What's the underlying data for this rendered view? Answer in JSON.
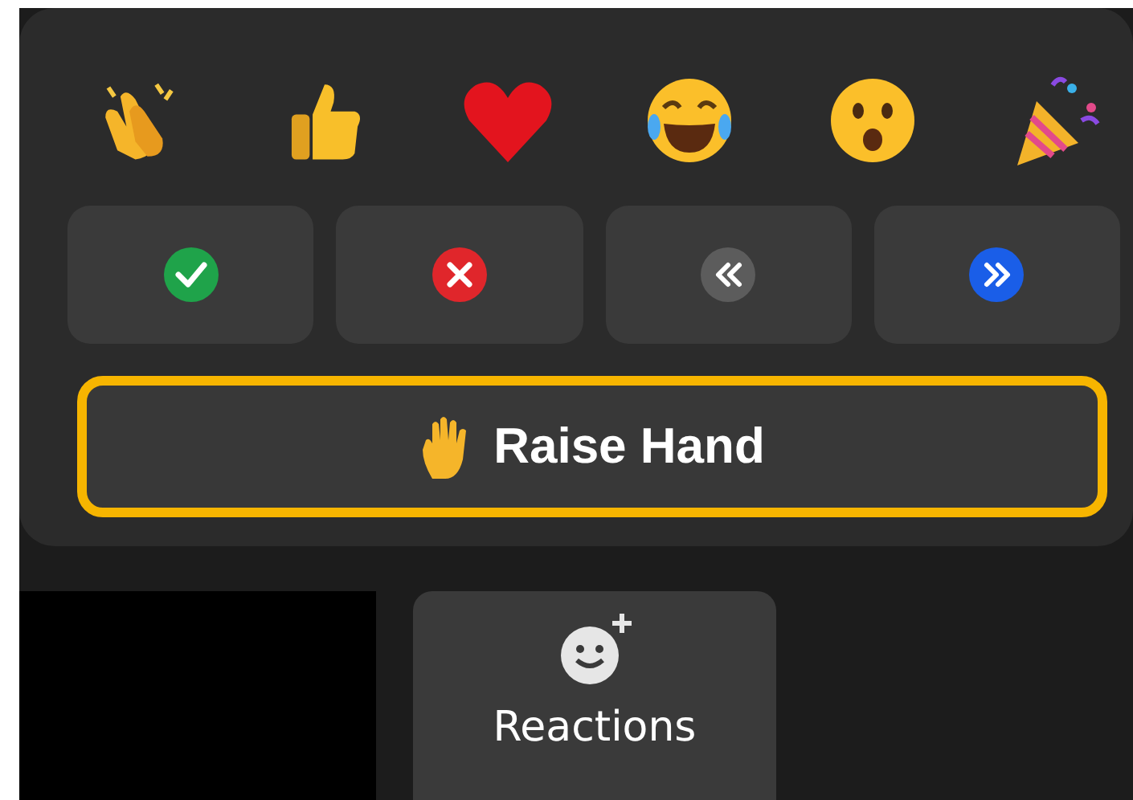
{
  "reactions": [
    {
      "kind": "clap"
    },
    {
      "kind": "thumbs_up"
    },
    {
      "kind": "heart"
    },
    {
      "kind": "laugh"
    },
    {
      "kind": "surprised"
    },
    {
      "kind": "party"
    }
  ],
  "feedback": [
    {
      "kind": "yes",
      "color": "#1fa34a"
    },
    {
      "kind": "no",
      "color": "#e0262b"
    },
    {
      "kind": "slower",
      "color": "#5c5c5c"
    },
    {
      "kind": "faster",
      "color": "#1a5ee8"
    }
  ],
  "raise_hand": {
    "label": "Raise Hand",
    "highlighted": true
  },
  "toolbar": {
    "reactions_button": {
      "label": "Reactions"
    }
  }
}
